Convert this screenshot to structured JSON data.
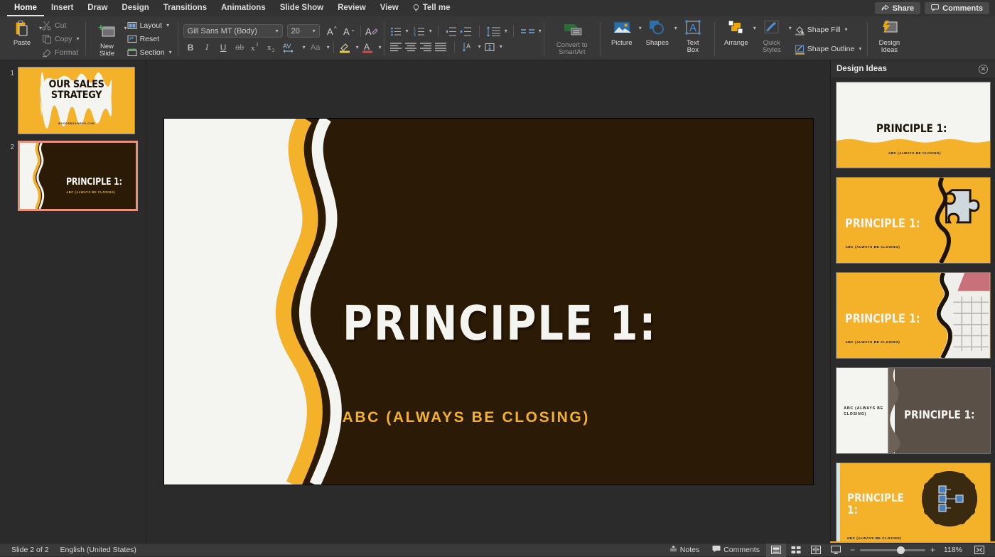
{
  "app": {
    "title": "PowerPoint"
  },
  "menubar": {
    "items": [
      {
        "label": "Home",
        "active": true
      },
      {
        "label": "Insert",
        "active": false
      },
      {
        "label": "Draw",
        "active": false
      },
      {
        "label": "Design",
        "active": false
      },
      {
        "label": "Transitions",
        "active": false
      },
      {
        "label": "Animations",
        "active": false
      },
      {
        "label": "Slide Show",
        "active": false
      },
      {
        "label": "Review",
        "active": false
      },
      {
        "label": "View",
        "active": false
      }
    ],
    "tell_me": "Tell me",
    "share": "Share",
    "comments": "Comments"
  },
  "ribbon": {
    "clipboard": {
      "paste": "Paste",
      "cut": "Cut",
      "copy": "Copy",
      "format": "Format"
    },
    "slides": {
      "new_slide": "New\nSlide",
      "new_slide_line1": "New",
      "new_slide_line2": "Slide",
      "layout": "Layout",
      "reset": "Reset",
      "section": "Section"
    },
    "font": {
      "name": "Gill Sans MT (Body)",
      "size": "20",
      "grow": "A",
      "shrink": "A",
      "clear_formatting": "A",
      "bold": "B",
      "italic": "I",
      "underline": "U",
      "strikethrough": "ab",
      "superscript": "x",
      "subscript": "x",
      "spacing": "AV",
      "change_case": "Aa",
      "highlight": "A",
      "font_color": "A"
    },
    "insert": {
      "convert_smartart_line1": "Convert to",
      "convert_smartart_line2": "SmartArt",
      "picture": "Picture",
      "shapes": "Shapes",
      "text_box_line1": "Text",
      "text_box_line2": "Box"
    },
    "drawing": {
      "arrange": "Arrange",
      "quick_styles_line1": "Quick",
      "quick_styles_line2": "Styles",
      "shape_fill": "Shape Fill",
      "shape_outline": "Shape Outline"
    },
    "designer": {
      "design_ideas_line1": "Design",
      "design_ideas_line2": "Ideas"
    }
  },
  "thumbnails": [
    {
      "number": "1",
      "selected": false,
      "title": "OUR SALES STRATEGY",
      "title_line1": "OUR SALES",
      "title_line2": "STRATEGY",
      "url": "WOODSBUSINESS.COM"
    },
    {
      "number": "2",
      "selected": true,
      "title": "PRINCIPLE 1:",
      "subtitle": "ABC (ALWAYS BE CLOSING)"
    }
  ],
  "slide": {
    "title": "PRINCIPLE 1:",
    "subtitle": "ABC (ALWAYS BE CLOSING)",
    "background_color": "#2b1a06",
    "accent_color": "#f3b229",
    "text_color": "#f4f4f1"
  },
  "design_ideas": {
    "header": "Design Ideas",
    "close": "✕",
    "cards": [
      {
        "title": "PRINCIPLE 1:",
        "subtitle": "ABC (ALWAYS BE CLOSING)",
        "style": "white-wave-band"
      },
      {
        "title": "PRINCIPLE 1:",
        "subtitle": "ABC (ALWAYS BE CLOSING)",
        "style": "orange-puzzle-photo"
      },
      {
        "title": "PRINCIPLE 1:",
        "subtitle": "ABC (ALWAYS BE CLOSING)",
        "style": "orange-calendar-photo"
      },
      {
        "title": "PRINCIPLE 1:",
        "subtitle": "ABC (ALWAYS BE CLOSING)",
        "style": "split-brown-white"
      },
      {
        "title": "PRINCIPLE 1:",
        "subtitle": "ABC (ALWAYS BE CLOSING)",
        "style": "orange-scallop-smartart"
      }
    ]
  },
  "statusbar": {
    "slide_count": "Slide 2 of 2",
    "language": "English (United States)",
    "notes": "Notes",
    "comments": "Comments",
    "zoom_value": "118%",
    "zoom_out": "−",
    "zoom_in": "+"
  }
}
